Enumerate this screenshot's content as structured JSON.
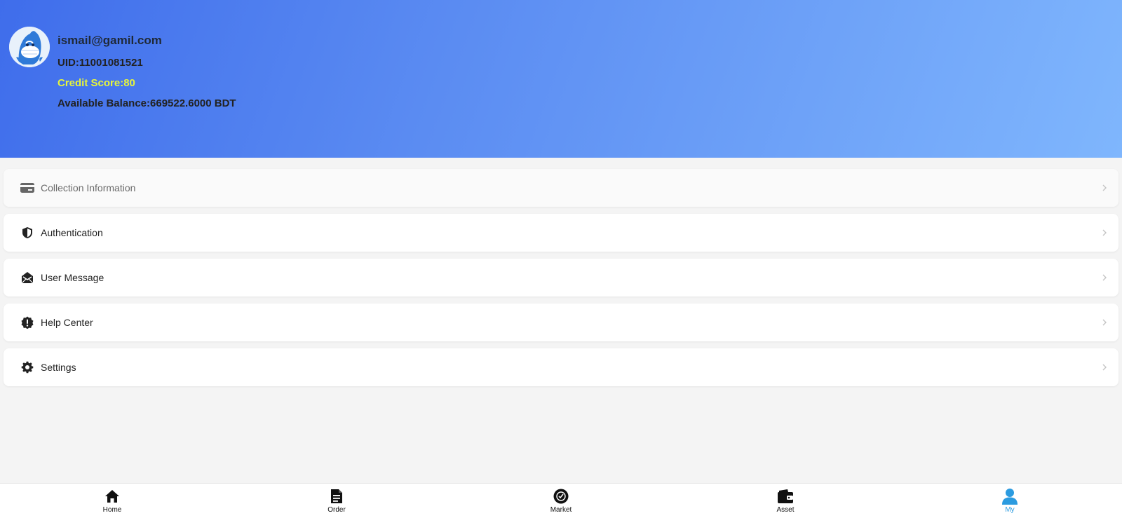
{
  "profile": {
    "email": "ismail@gamil.com",
    "uid": "UID:11001081521",
    "credit_score": "Credit Score:80",
    "balance": "Available Balance:669522.6000 BDT"
  },
  "menu": {
    "items": [
      {
        "label": "Collection Information",
        "icon": "card-icon"
      },
      {
        "label": "Authentication",
        "icon": "shield-icon"
      },
      {
        "label": "User Message",
        "icon": "envelope-icon"
      },
      {
        "label": "Help Center",
        "icon": "help-badge-icon"
      },
      {
        "label": "Settings",
        "icon": "gear-icon"
      }
    ]
  },
  "tabbar": {
    "items": [
      {
        "label": "Home",
        "icon": "home-icon"
      },
      {
        "label": "Order",
        "icon": "document-icon"
      },
      {
        "label": "Market",
        "icon": "market-icon"
      },
      {
        "label": "Asset",
        "icon": "wallet-icon"
      },
      {
        "label": "My",
        "icon": "user-icon"
      }
    ],
    "active": "My"
  },
  "colors": {
    "header_gradient_start": "#3f6deb",
    "header_gradient_end": "#7fb6fd",
    "credit_score": "#e6f53b",
    "active_tab": "#2b9be0"
  }
}
